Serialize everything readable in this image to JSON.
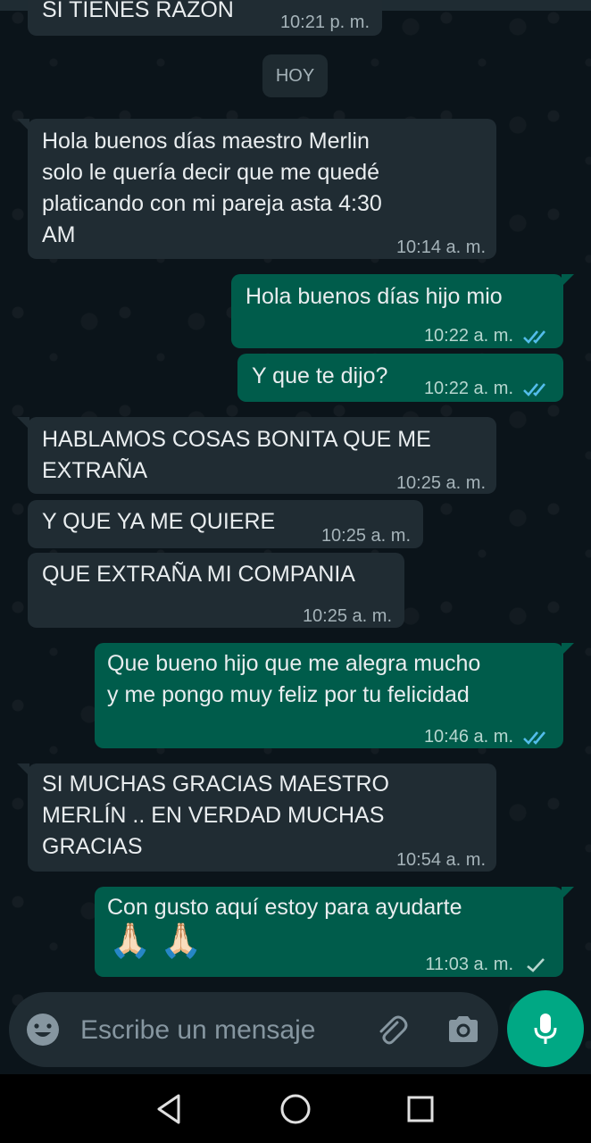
{
  "prev_message": {
    "text": "SI TIENES RAZON",
    "time": "10:21 p. m."
  },
  "date_chip": "HOY",
  "messages": [
    {
      "dir": "in",
      "text": "Hola buenos días maestro Merlin\nsolo le quería decir que me quedé\nplaticando con mi pareja asta 4:30\nAM",
      "time": "10:14 a. m."
    },
    {
      "dir": "out",
      "text": "Hola buenos días hijo mio",
      "time": "10:22 a. m.",
      "status": "read"
    },
    {
      "dir": "out",
      "text": "Y que te dijo?",
      "time": "10:22 a. m.",
      "status": "read"
    },
    {
      "dir": "in",
      "text": "HABLAMOS COSAS BONITA QUE ME\nEXTRAÑA",
      "time": "10:25 a. m."
    },
    {
      "dir": "in",
      "text": "Y QUE YA ME QUIERE",
      "time": "10:25 a. m."
    },
    {
      "dir": "in",
      "text": "QUE EXTRAÑA MI COMPANIA",
      "time": "10:25 a. m."
    },
    {
      "dir": "out",
      "text": "Que bueno hijo que me alegra mucho\ny me pongo muy feliz por tu felicidad",
      "time": "10:46 a. m.",
      "status": "read"
    },
    {
      "dir": "in",
      "text": "SI MUCHAS GRACIAS MAESTRO\nMERLÍN .. EN VERDAD MUCHAS\nGRACIAS",
      "time": "10:54 a. m."
    },
    {
      "dir": "out",
      "text": "Con gusto aquí estoy para ayudarte",
      "emoji": "🙏🏻🙏🏻",
      "time": "11:03 a. m.",
      "status": "sent"
    }
  ],
  "composer": {
    "placeholder": "Escribe un mensaje"
  },
  "colors": {
    "incoming": "#202c33",
    "outgoing": "#005c4b",
    "accent": "#00a884",
    "read_tick": "#53bdeb"
  },
  "icons": [
    "emoji-icon",
    "attach-icon",
    "camera-icon",
    "mic-icon",
    "back-nav-icon",
    "home-nav-icon",
    "recents-nav-icon"
  ]
}
